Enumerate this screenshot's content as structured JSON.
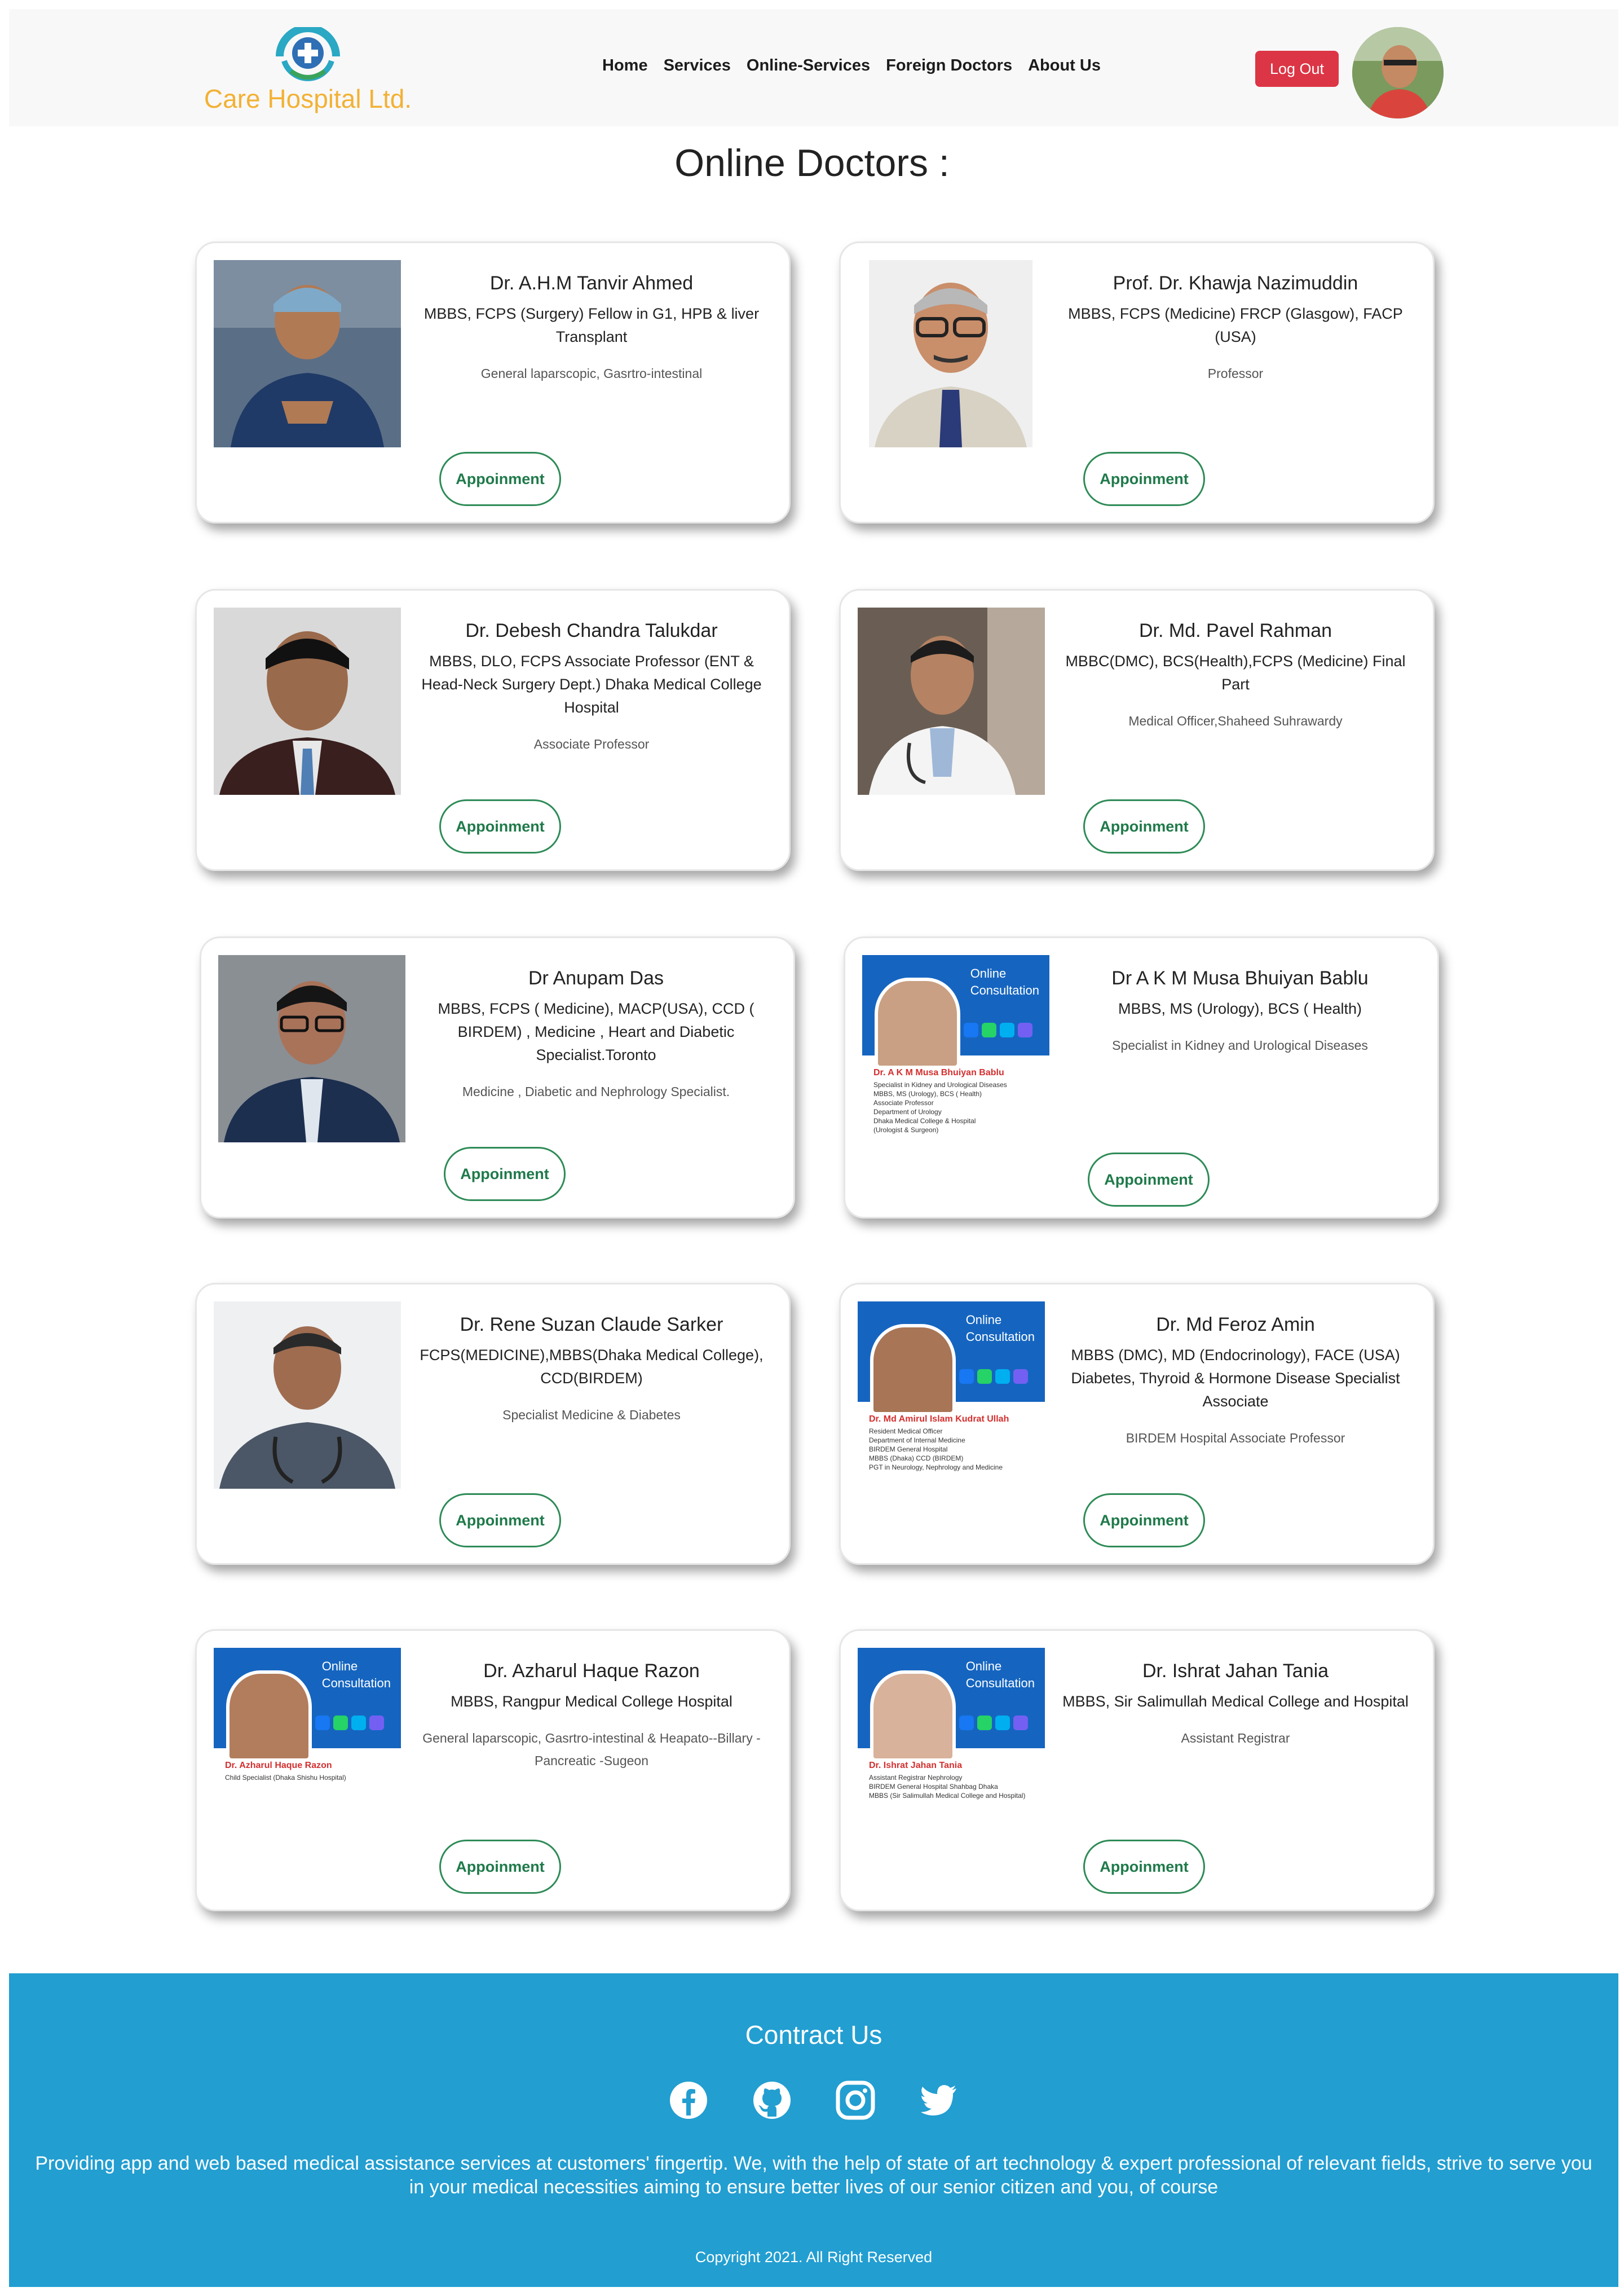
{
  "navbar": {
    "brand_name": "Care Hospital Ltd.",
    "links": [
      "Home",
      "Services",
      "Online-Services",
      "Foreign Doctors",
      "About Us"
    ],
    "logout_label": "Log Out"
  },
  "page_title": "Online Doctors :",
  "appointment_label": "Appoinment",
  "doctors": [
    {
      "name": "Dr. A.H.M Tanvir Ahmed",
      "degree": "MBBS, FCPS (Surgery) Fellow in G1, HPB & liver Transplant",
      "spec": "General laparscopic, Gasrtro-intestinal"
    },
    {
      "name": "Prof. Dr. Khawja Nazimuddin",
      "degree": "MBBS, FCPS (Medicine) FRCP (Glasgow), FACP (USA)",
      "spec": "Professor"
    },
    {
      "name": "Dr. Debesh Chandra Talukdar",
      "degree": "MBBS, DLO, FCPS Associate Professor (ENT & Head-Neck Surgery Dept.) Dhaka Medical College Hospital",
      "spec": "Associate Professor"
    },
    {
      "name": "Dr. Md. Pavel Rahman",
      "degree": "MBBC(DMC), BCS(Health),FCPS (Medicine) Final Part",
      "spec": "Medical Officer,Shaheed Suhrawardy"
    },
    {
      "name": "Dr Anupam Das",
      "degree": "MBBS, FCPS ( Medicine), MACP(USA), CCD ( BIRDEM) , Medicine , Heart and Diabetic Specialist.Toronto",
      "spec": "Medicine , Diabetic and Nephrology Specialist."
    },
    {
      "name": "Dr A K M Musa Bhuiyan Bablu",
      "degree": "MBBS, MS (Urology), BCS ( Health)",
      "spec": "Specialist in Kidney and Urological Diseases"
    },
    {
      "name": "Dr. Rene Suzan Claude Sarker",
      "degree": "FCPS(MEDICINE),MBBS(Dhaka Medical College), CCD(BIRDEM)",
      "spec": "Specialist Medicine & Diabetes"
    },
    {
      "name": "Dr. Md Feroz Amin",
      "degree": "MBBS (DMC), MD (Endocrinology), FACE (USA) Diabetes, Thyroid & Hormone Disease Specialist Associate",
      "spec": "BIRDEM Hospital Associate Professor"
    },
    {
      "name": "Dr. Azharul Haque Razon",
      "degree": "MBBS, Rangpur Medical College Hospital",
      "spec": "General laparscopic, Gasrtro-intestinal & Heapato--Billary -Pancreatic -Sugeon"
    },
    {
      "name": "Dr. Ishrat Jahan Tania",
      "degree": "MBBS, Sir Salimullah Medical College and Hospital",
      "spec": "Assistant Registrar"
    }
  ],
  "consult_cards": {
    "banner_line1": "Online",
    "banner_line2": "Consultation",
    "musa": {
      "name": "Dr. A K M Musa Bhuiyan Bablu",
      "lines": [
        "Specialist in Kidney and Urological Diseases",
        "MBBS, MS (Urology), BCS ( Health)",
        "Associate Professor",
        "Department of Urology",
        "Dhaka Medical College & Hospital",
        "(Urologist & Surgeon)"
      ]
    },
    "feroz": {
      "name": "Dr. Md Amirul Islam Kudrat Ullah",
      "lines": [
        "Resident Medical Officer",
        "Department of Internal Medicine",
        "BIRDEM General Hospital",
        "MBBS (Dhaka) CCD (BIRDEM)",
        "PGT in Neurology, Nephrology and Medicine"
      ]
    },
    "azharul": {
      "name": "Dr. Azharul Haque Razon",
      "lines": [
        "Child Specialist (Dhaka Shishu Hospital)"
      ]
    },
    "tania": {
      "name": "Dr. Ishrat Jahan Tania",
      "lines": [
        "Assistant Registrar Nephrology",
        "BIRDEM General Hospital Shahbag Dhaka",
        "MBBS (Sir Salimullah Medical College and Hospital)"
      ]
    }
  },
  "footer": {
    "title": "Contract Us",
    "socials": [
      "facebook-icon",
      "github-icon",
      "instagram-icon",
      "twitter-icon"
    ],
    "text": "Providing app and web based medical assistance services at customers' fingertip. We, with the help of state of art technology & expert professional of relevant fields, strive to serve you in your medical necessities aiming to ensure better lives of our senior citizen and you, of course",
    "copyright": "Copyright 2021. All Right Reserved"
  },
  "colors": {
    "brand": "#f2b134",
    "logout": "#dc3545",
    "appointment": "#2e8b57",
    "footer": "#229ed1"
  }
}
